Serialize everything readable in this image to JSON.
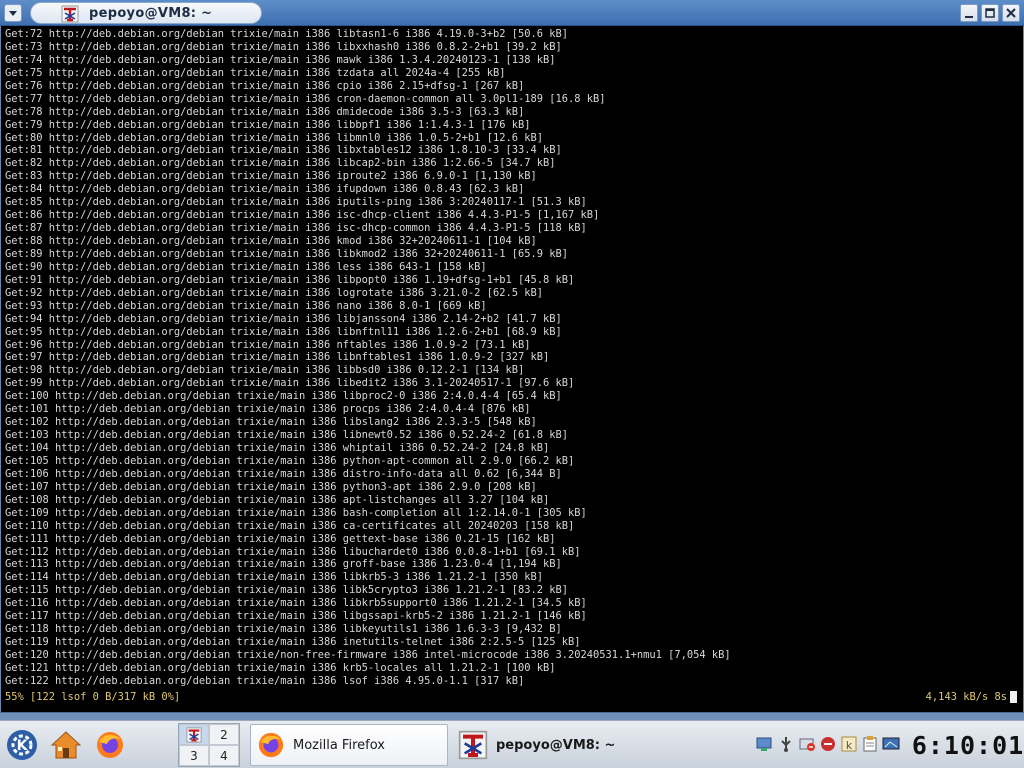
{
  "window": {
    "title": "pepoyo@VM8: ~"
  },
  "terminal": {
    "lines": [
      "Get:72 http://deb.debian.org/debian trixie/main i386 libtasn1-6 i386 4.19.0-3+b2 [50.6 kB]",
      "Get:73 http://deb.debian.org/debian trixie/main i386 libxxhash0 i386 0.8.2-2+b1 [39.2 kB]",
      "Get:74 http://deb.debian.org/debian trixie/main i386 mawk i386 1.3.4.20240123-1 [138 kB]",
      "Get:75 http://deb.debian.org/debian trixie/main i386 tzdata all 2024a-4 [255 kB]",
      "Get:76 http://deb.debian.org/debian trixie/main i386 cpio i386 2.15+dfsg-1 [267 kB]",
      "Get:77 http://deb.debian.org/debian trixie/main i386 cron-daemon-common all 3.0pl1-189 [16.8 kB]",
      "Get:78 http://deb.debian.org/debian trixie/main i386 dmidecode i386 3.5-3 [63.3 kB]",
      "Get:79 http://deb.debian.org/debian trixie/main i386 libbpf1 i386 1:1.4.3-1 [176 kB]",
      "Get:80 http://deb.debian.org/debian trixie/main i386 libmnl0 i386 1.0.5-2+b1 [12.6 kB]",
      "Get:81 http://deb.debian.org/debian trixie/main i386 libxtables12 i386 1.8.10-3 [33.4 kB]",
      "Get:82 http://deb.debian.org/debian trixie/main i386 libcap2-bin i386 1:2.66-5 [34.7 kB]",
      "Get:83 http://deb.debian.org/debian trixie/main i386 iproute2 i386 6.9.0-1 [1,130 kB]",
      "Get:84 http://deb.debian.org/debian trixie/main i386 ifupdown i386 0.8.43 [62.3 kB]",
      "Get:85 http://deb.debian.org/debian trixie/main i386 iputils-ping i386 3:20240117-1 [51.3 kB]",
      "Get:86 http://deb.debian.org/debian trixie/main i386 isc-dhcp-client i386 4.4.3-P1-5 [1,167 kB]",
      "Get:87 http://deb.debian.org/debian trixie/main i386 isc-dhcp-common i386 4.4.3-P1-5 [118 kB]",
      "Get:88 http://deb.debian.org/debian trixie/main i386 kmod i386 32+20240611-1 [104 kB]",
      "Get:89 http://deb.debian.org/debian trixie/main i386 libkmod2 i386 32+20240611-1 [65.9 kB]",
      "Get:90 http://deb.debian.org/debian trixie/main i386 less i386 643-1 [158 kB]",
      "Get:91 http://deb.debian.org/debian trixie/main i386 libpopt0 i386 1.19+dfsg-1+b1 [45.8 kB]",
      "Get:92 http://deb.debian.org/debian trixie/main i386 logrotate i386 3.21.0-2 [62.5 kB]",
      "Get:93 http://deb.debian.org/debian trixie/main i386 nano i386 8.0-1 [669 kB]",
      "Get:94 http://deb.debian.org/debian trixie/main i386 libjansson4 i386 2.14-2+b2 [41.7 kB]",
      "Get:95 http://deb.debian.org/debian trixie/main i386 libnftnl11 i386 1.2.6-2+b1 [68.9 kB]",
      "Get:96 http://deb.debian.org/debian trixie/main i386 nftables i386 1.0.9-2 [73.1 kB]",
      "Get:97 http://deb.debian.org/debian trixie/main i386 libnftables1 i386 1.0.9-2 [327 kB]",
      "Get:98 http://deb.debian.org/debian trixie/main i386 libbsd0 i386 0.12.2-1 [134 kB]",
      "Get:99 http://deb.debian.org/debian trixie/main i386 libedit2 i386 3.1-20240517-1 [97.6 kB]",
      "Get:100 http://deb.debian.org/debian trixie/main i386 libproc2-0 i386 2:4.0.4-4 [65.4 kB]",
      "Get:101 http://deb.debian.org/debian trixie/main i386 procps i386 2:4.0.4-4 [876 kB]",
      "Get:102 http://deb.debian.org/debian trixie/main i386 libslang2 i386 2.3.3-5 [548 kB]",
      "Get:103 http://deb.debian.org/debian trixie/main i386 libnewt0.52 i386 0.52.24-2 [61.8 kB]",
      "Get:104 http://deb.debian.org/debian trixie/main i386 whiptail i386 0.52.24-2 [24.8 kB]",
      "Get:105 http://deb.debian.org/debian trixie/main i386 python-apt-common all 2.9.0 [66.2 kB]",
      "Get:106 http://deb.debian.org/debian trixie/main i386 distro-info-data all 0.62 [6,344 B]",
      "Get:107 http://deb.debian.org/debian trixie/main i386 python3-apt i386 2.9.0 [208 kB]",
      "Get:108 http://deb.debian.org/debian trixie/main i386 apt-listchanges all 3.27 [104 kB]",
      "Get:109 http://deb.debian.org/debian trixie/main i386 bash-completion all 1:2.14.0-1 [305 kB]",
      "Get:110 http://deb.debian.org/debian trixie/main i386 ca-certificates all 20240203 [158 kB]",
      "Get:111 http://deb.debian.org/debian trixie/main i386 gettext-base i386 0.21-15 [162 kB]",
      "Get:112 http://deb.debian.org/debian trixie/main i386 libuchardet0 i386 0.0.8-1+b1 [69.1 kB]",
      "Get:113 http://deb.debian.org/debian trixie/main i386 groff-base i386 1.23.0-4 [1,194 kB]",
      "Get:114 http://deb.debian.org/debian trixie/main i386 libkrb5-3 i386 1.21.2-1 [350 kB]",
      "Get:115 http://deb.debian.org/debian trixie/main i386 libk5crypto3 i386 1.21.2-1 [83.2 kB]",
      "Get:116 http://deb.debian.org/debian trixie/main i386 libkrb5support0 i386 1.21.2-1 [34.5 kB]",
      "Get:117 http://deb.debian.org/debian trixie/main i386 libgssapi-krb5-2 i386 1.21.2-1 [146 kB]",
      "Get:118 http://deb.debian.org/debian trixie/main i386 libkeyutils1 i386 1.6.3-3 [9,432 B]",
      "Get:119 http://deb.debian.org/debian trixie/main i386 inetutils-telnet i386 2:2.5-5 [125 kB]",
      "Get:120 http://deb.debian.org/debian trixie/non-free-firmware i386 intel-microcode i386 3.20240531.1+nmu1 [7,054 kB]",
      "Get:121 http://deb.debian.org/debian trixie/main i386 krb5-locales all 1.21.2-1 [100 kB]",
      "Get:122 http://deb.debian.org/debian trixie/main i386 lsof i386 4.95.0-1.1 [317 kB]"
    ],
    "status_left": "55% [122 lsof 0 B/317 kB 0%]",
    "status_right": "4,143 kB/s 8s"
  },
  "taskbar": {
    "pager": [
      "1",
      "2",
      "3",
      "4"
    ],
    "tasks": {
      "firefox": "Mozilla Firefox",
      "terminal": "pepoyo@VM8: ~"
    },
    "clock": "6:10:01",
    "tray_icons": [
      "network-icon",
      "usb-icon",
      "update-icon",
      "security-icon",
      "keyboard-icon",
      "clipboard-icon",
      "display-icon"
    ]
  }
}
